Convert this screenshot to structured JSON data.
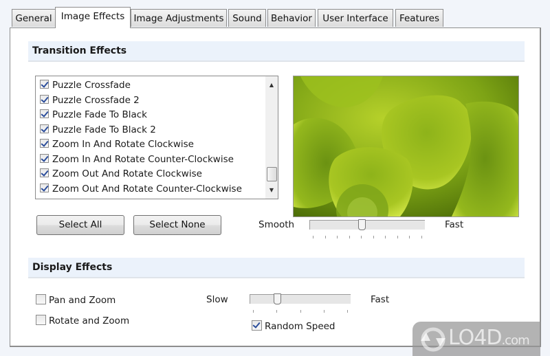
{
  "tabs": [
    {
      "label": "General",
      "active": false
    },
    {
      "label": "Image Effects",
      "active": true
    },
    {
      "label": "Image Adjustments",
      "active": false
    },
    {
      "label": "Sound",
      "active": false
    },
    {
      "label": "Behavior",
      "active": false
    },
    {
      "label": "User Interface",
      "active": false
    },
    {
      "label": "Features",
      "active": false
    }
  ],
  "transition_effects": {
    "title": "Transition Effects",
    "items": [
      {
        "label": "Puzzle Crossfade",
        "checked": true
      },
      {
        "label": "Puzzle Crossfade 2",
        "checked": true
      },
      {
        "label": "Puzzle Fade To Black",
        "checked": true
      },
      {
        "label": "Puzzle Fade To Black 2",
        "checked": true
      },
      {
        "label": "Zoom In And Rotate Clockwise",
        "checked": true
      },
      {
        "label": "Zoom In And Rotate Counter-Clockwise",
        "checked": true
      },
      {
        "label": "Zoom Out And Rotate Clockwise",
        "checked": true
      },
      {
        "label": "Zoom Out And Rotate Counter-Clockwise",
        "checked": true
      }
    ],
    "select_all_label": "Select All",
    "select_none_label": "Select None",
    "speed_slider": {
      "min_label": "Smooth",
      "max_label": "Fast",
      "value_fraction": 0.44,
      "tick_count": 10
    }
  },
  "display_effects": {
    "title": "Display Effects",
    "pan_and_zoom": {
      "label": "Pan and Zoom",
      "checked": false
    },
    "rotate_and_zoom": {
      "label": "Rotate and Zoom",
      "checked": false
    },
    "speed_slider": {
      "min_label": "Slow",
      "max_label": "Fast",
      "value_fraction": 0.25,
      "tick_count": 5
    },
    "random_speed": {
      "label": "Random Speed",
      "checked": true
    }
  },
  "preview": {
    "description": "green succulent leaves photo"
  },
  "watermark": {
    "text": "LO4D",
    "suffix": ".com"
  }
}
